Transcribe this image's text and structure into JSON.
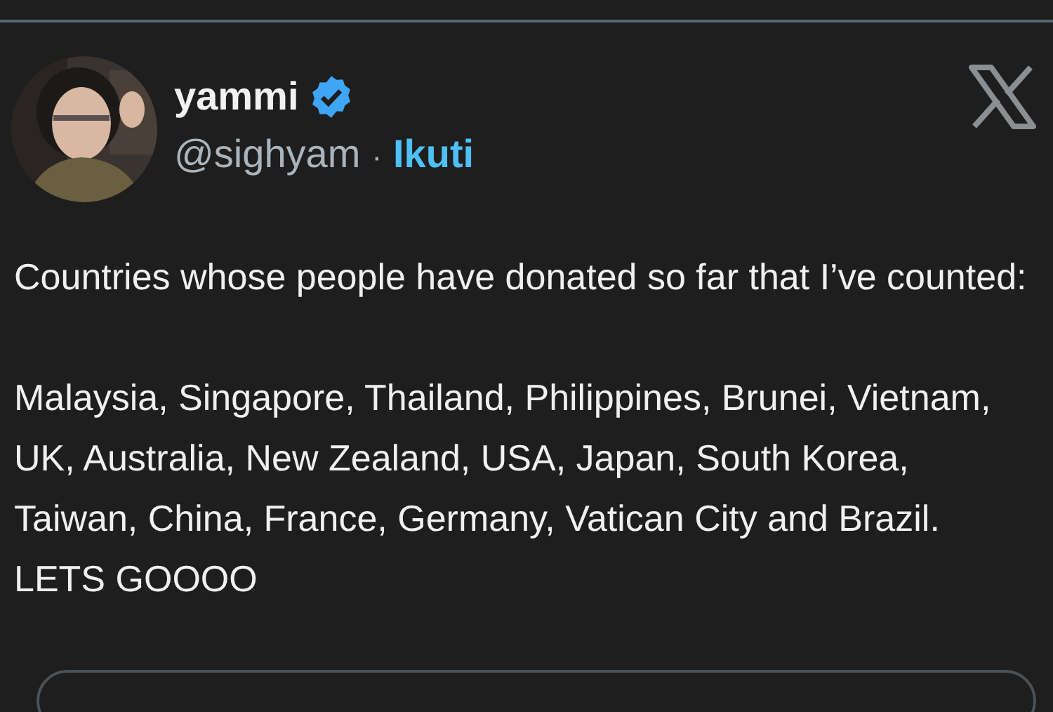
{
  "author": {
    "name": "yammi",
    "verified": true,
    "handle": "@sighyam",
    "separator": "·",
    "follow_link": "Ikuti"
  },
  "post": {
    "paragraphs": [
      "Countries whose people have donated so far that I’ve counted:",
      "Malaysia, Singapore, Thailand, Philippines, Brunei, Vietnam, UK, Australia, New Zealand, USA, Japan, South Korea, Taiwan, China, France, Germany, Vatican City and Brazil. LETS GOOOO"
    ]
  }
}
